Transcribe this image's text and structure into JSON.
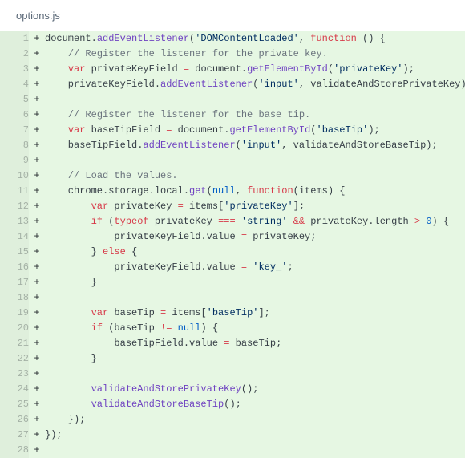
{
  "file": {
    "name": "options.js"
  },
  "diff": {
    "marker": "+",
    "lines": [
      {
        "n": 1,
        "html": "document.<span class='f'>addEventListener</span>(<span class='s'>'DOMContentLoaded'</span>, <span class='k'>function</span> () {"
      },
      {
        "n": 2,
        "html": "    <span class='c'>// Register the listener for the private key.</span>"
      },
      {
        "n": 3,
        "html": "    <span class='k'>var</span> privateKeyField <span class='k'>=</span> document.<span class='f'>getElementById</span>(<span class='s'>'privateKey'</span>);"
      },
      {
        "n": 4,
        "html": "    privateKeyField.<span class='f'>addEventListener</span>(<span class='s'>'input'</span>, validateAndStorePrivateKey);"
      },
      {
        "n": 5,
        "html": ""
      },
      {
        "n": 6,
        "html": "    <span class='c'>// Register the listener for the base tip.</span>"
      },
      {
        "n": 7,
        "html": "    <span class='k'>var</span> baseTipField <span class='k'>=</span> document.<span class='f'>getElementById</span>(<span class='s'>'baseTip'</span>);"
      },
      {
        "n": 8,
        "html": "    baseTipField.<span class='f'>addEventListener</span>(<span class='s'>'input'</span>, validateAndStoreBaseTip);"
      },
      {
        "n": 9,
        "html": ""
      },
      {
        "n": 10,
        "html": "    <span class='c'>// Load the values.</span>"
      },
      {
        "n": 11,
        "html": "    chrome.storage.local.<span class='f'>get</span>(<span class='n'>null</span>, <span class='k'>function</span>(items) {"
      },
      {
        "n": 12,
        "html": "        <span class='k'>var</span> privateKey <span class='k'>=</span> items[<span class='s'>'privateKey'</span>];"
      },
      {
        "n": 13,
        "html": "        <span class='k'>if</span> (<span class='k'>typeof</span> privateKey <span class='k'>===</span> <span class='s'>'string'</span> <span class='k'>&amp;&amp;</span> privateKey.length <span class='k'>&gt;</span> <span class='n'>0</span>) {"
      },
      {
        "n": 14,
        "html": "            privateKeyField.value <span class='k'>=</span> privateKey;"
      },
      {
        "n": 15,
        "html": "        } <span class='k'>else</span> {"
      },
      {
        "n": 16,
        "html": "            privateKeyField.value <span class='k'>=</span> <span class='s'>'key_'</span>;"
      },
      {
        "n": 17,
        "html": "        }"
      },
      {
        "n": 18,
        "html": ""
      },
      {
        "n": 19,
        "html": "        <span class='k'>var</span> baseTip <span class='k'>=</span> items[<span class='s'>'baseTip'</span>];"
      },
      {
        "n": 20,
        "html": "        <span class='k'>if</span> (baseTip <span class='k'>!=</span> <span class='n'>null</span>) {"
      },
      {
        "n": 21,
        "html": "            baseTipField.value <span class='k'>=</span> baseTip;"
      },
      {
        "n": 22,
        "html": "        }"
      },
      {
        "n": 23,
        "html": ""
      },
      {
        "n": 24,
        "html": "        <span class='f'>validateAndStorePrivateKey</span>();"
      },
      {
        "n": 25,
        "html": "        <span class='f'>validateAndStoreBaseTip</span>();"
      },
      {
        "n": 26,
        "html": "    });"
      },
      {
        "n": 27,
        "html": "});"
      },
      {
        "n": 28,
        "html": ""
      }
    ]
  }
}
